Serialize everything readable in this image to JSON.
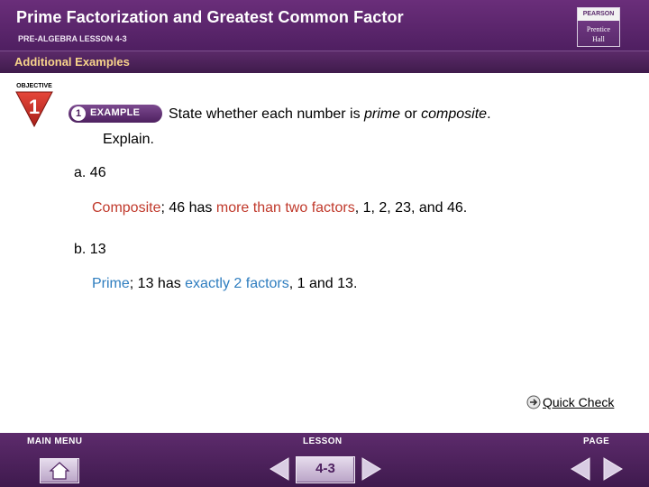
{
  "header": {
    "title": "Prime Factorization and Greatest Common Factor",
    "subtitle": "PRE-ALGEBRA LESSON 4-3",
    "logo_top": "PEARSON",
    "logo_line1": "Prentice",
    "logo_line2": "Hall"
  },
  "section_bar": {
    "label": "Additional Examples"
  },
  "objective": {
    "label": "OBJECTIVE",
    "number": "1"
  },
  "example": {
    "number": "1",
    "label": "EXAMPLE"
  },
  "problem": {
    "line1_a": "State whether each number is ",
    "prime": "prime",
    "or": " or ",
    "composite": "composite",
    "period": ".",
    "line2": "Explain."
  },
  "parts": [
    {
      "label": "a. 46",
      "answer": {
        "keyword": "Composite",
        "t1": "; 46 has ",
        "highlight": "more than two factors",
        "t2": ", 1, 2, 23, and 46."
      }
    },
    {
      "label": "b. 13",
      "answer": {
        "keyword": "Prime",
        "t1": "; 13 has ",
        "highlight": "exactly 2 factors",
        "t2": ", 1 and 13."
      }
    }
  ],
  "quick_check": {
    "label": "Quick Check"
  },
  "footer": {
    "main_menu": "MAIN MENU",
    "lesson": "LESSON",
    "page": "PAGE",
    "lesson_number": "4-3"
  },
  "colors": {
    "header_purple": "#5b2a69",
    "accent_gold": "#f7d38a",
    "answer_red": "#c0392b",
    "answer_blue": "#2e7dbf"
  }
}
